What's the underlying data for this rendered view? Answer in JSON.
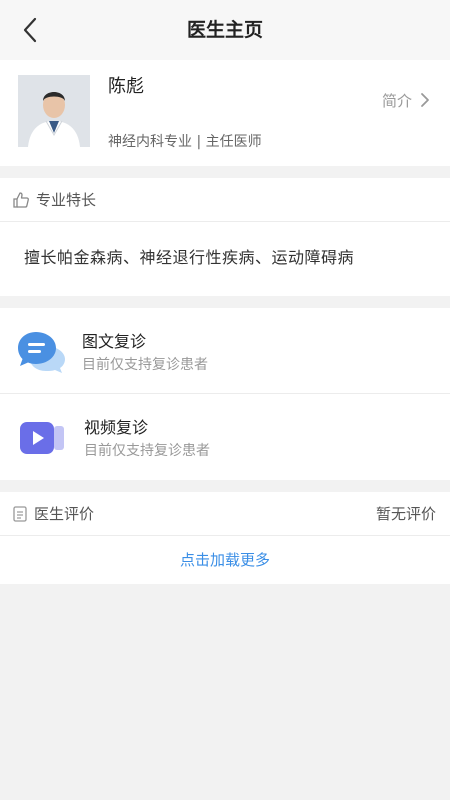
{
  "header": {
    "title": "医生主页"
  },
  "doctor": {
    "name": "陈彪",
    "meta": "神经内科专业 | 主任医师",
    "intro_label": "简介"
  },
  "specialty": {
    "label": "专业特长",
    "text": "擅长帕金森病、神经退行性疾病、运动障碍病"
  },
  "services": [
    {
      "title": "图文复诊",
      "subtitle": "目前仅支持复诊患者",
      "icon": "chat-bubble-icon"
    },
    {
      "title": "视频复诊",
      "subtitle": "目前仅支持复诊患者",
      "icon": "video-camera-icon"
    }
  ],
  "reviews": {
    "label": "医生评价",
    "status": "暂无评价",
    "load_more": "点击加载更多"
  },
  "colors": {
    "accent": "#3a8ee6",
    "chat_icon": "#4a90e2",
    "video_icon": "#6a6ee8"
  }
}
